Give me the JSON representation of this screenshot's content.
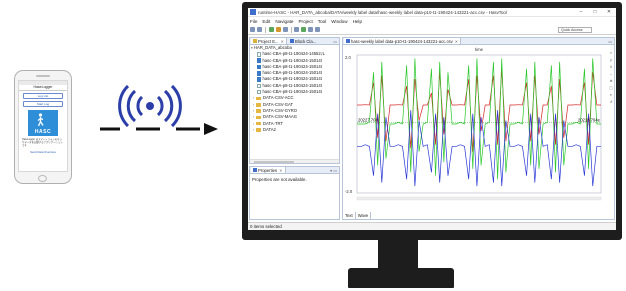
{
  "phone": {
    "screen_title": "HaseLogger",
    "button_1": "Log List",
    "button_2": "Start Log",
    "logo_word": "HASC",
    "description": "HaseLogger はスマートフォンのセンサデータを記録するアプリケーションです",
    "link": "Send Data Overview"
  },
  "window": {
    "title": "runtime-HASC - HAR_DATA_abcoba/DATA/weekly label data/hasc-weekly label data-p10-t1-190424-143221-acc.csv - HasvTool",
    "controls": [
      "–",
      "□",
      "✕"
    ]
  },
  "menu": [
    "File",
    "Edit",
    "Navigate",
    "Project",
    "Tool",
    "Window",
    "Help"
  ],
  "toolbar": {
    "quick_access": "Quick Access"
  },
  "project_pane": {
    "tabs": [
      "Project E...",
      "Block Cla..."
    ],
    "root": "HAR_DATA_abcoba",
    "files": [
      "hasc-CBA-p8-t1-190424-14552ル",
      "hasc-CBA-p8-t1-190424-15014t",
      "hasc-CBA-p8-t1-190424-15014t",
      "hasc-CBA-p8-t1-190424-15014t",
      "hasc-CBA-p8-t1-190424-15014t",
      "hasc-CBA-p8-t1-190424-15014t",
      "hasc-CBA-p8-t1-190424-15014t"
    ],
    "folders": [
      "DATA-CSV-ACC",
      "DATA-CSV-GAT",
      "DATA-CSV-GYRO",
      "DATA-CSV-MAAG",
      "DATA-TRT",
      "DATA2"
    ]
  },
  "properties_pane": {
    "tab": "Properties",
    "message": "Properties are not available."
  },
  "editor": {
    "tab": "hasc-weekly label data-p10-t1-190424-143221-acc.csv",
    "header_label": "time",
    "bottom_tabs": [
      "Text",
      "Wave"
    ],
    "right_tools": [
      "×",
      "y",
      "⇕",
      "⇔",
      "⊕",
      "▢",
      "≡",
      "↺"
    ]
  },
  "status": {
    "text": "0 items selected"
  },
  "colors": {
    "x_series": "#d62828",
    "y_series": "#28c828",
    "z_series": "#2838d6",
    "accent": "#3e6ec9"
  },
  "chart_data": {
    "type": "line",
    "ylim": [
      -2.0,
      2.0
    ],
    "ytick_labels": [
      "2.0",
      "-2.0"
    ],
    "marker_labels": [
      "20227.704",
      "20218.794e"
    ],
    "x": [
      0,
      1,
      2,
      3,
      4,
      5,
      6,
      7,
      8,
      9,
      10,
      11,
      12,
      13,
      14,
      15,
      16,
      17,
      18,
      19,
      20,
      21,
      22,
      23,
      24,
      25,
      26,
      27,
      28,
      29,
      30,
      31,
      32,
      33,
      34,
      35,
      36,
      37,
      38,
      39,
      40,
      41,
      42,
      43,
      44,
      45,
      46,
      47,
      48,
      49,
      50,
      51,
      52,
      53,
      54,
      55,
      56,
      57,
      58,
      59
    ],
    "series": [
      {
        "values": [
          0.55,
          0.55,
          0.56,
          0.55,
          1.2,
          -0.4,
          1.4,
          -0.5,
          0.55,
          0.55,
          0.56,
          0.55,
          1.1,
          -0.7,
          1.3,
          0.1,
          0.55,
          0.55,
          0.9,
          -0.6,
          1.5,
          -0.3,
          1.0,
          0.55,
          0.55,
          0.56,
          0.55,
          1.3,
          -0.8,
          1.4,
          -0.2,
          0.55,
          0.55,
          1.4,
          -0.6,
          1.6,
          -0.5,
          0.55,
          0.55,
          0.56,
          0.55,
          1.2,
          -0.5,
          1.4,
          -0.3,
          0.55,
          0.55,
          1.1,
          -0.6,
          1.3,
          -0.4,
          0.55,
          0.55,
          0.56,
          0.55,
          1.2,
          -0.6,
          1.5,
          0.55,
          0.55
        ]
      },
      {
        "values": [
          0.0,
          0.0,
          0.0,
          0.05,
          1.5,
          -1.2,
          1.8,
          -1.0,
          0.0,
          0.0,
          0.05,
          0.0,
          1.7,
          -1.4,
          1.9,
          -0.8,
          0.0,
          0.05,
          1.6,
          -1.5,
          1.8,
          -1.1,
          1.5,
          0.0,
          0.0,
          0.05,
          0.0,
          1.7,
          -1.3,
          1.9,
          -1.2,
          0.0,
          0.05,
          1.8,
          -1.6,
          1.9,
          -1.4,
          0.0,
          0.0,
          0.05,
          0.0,
          1.6,
          -1.2,
          1.8,
          -1.3,
          0.0,
          0.05,
          1.7,
          -1.4,
          1.8,
          -1.2,
          0.0,
          0.0,
          0.05,
          0.0,
          1.6,
          -1.3,
          1.9,
          0.0,
          0.0
        ]
      },
      {
        "values": [
          -0.65,
          -0.65,
          -0.6,
          -0.65,
          -1.5,
          0.3,
          -1.7,
          0.2,
          -0.65,
          -0.65,
          -0.6,
          -0.65,
          -1.6,
          0.4,
          -1.8,
          0.1,
          -0.65,
          -0.6,
          -1.4,
          0.3,
          -1.7,
          0.2,
          -1.5,
          -0.65,
          -0.65,
          -0.6,
          -0.65,
          -1.6,
          0.3,
          -1.8,
          0.2,
          -0.65,
          -0.6,
          -1.7,
          0.4,
          -1.8,
          0.1,
          -0.65,
          -0.65,
          -0.6,
          -0.65,
          -1.5,
          0.3,
          -1.7,
          0.2,
          -0.65,
          -0.6,
          -1.6,
          0.3,
          -1.7,
          0.1,
          -0.65,
          -0.65,
          -0.6,
          -0.65,
          -1.5,
          0.3,
          -1.8,
          -0.65,
          -0.65
        ]
      }
    ]
  }
}
